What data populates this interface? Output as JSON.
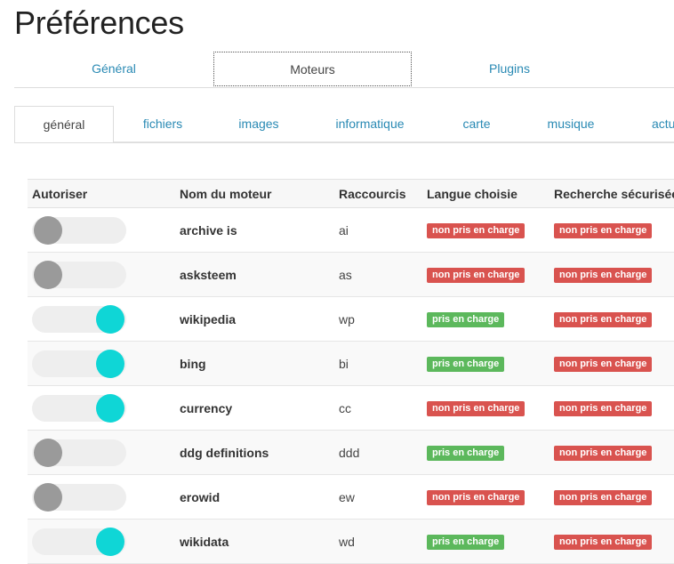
{
  "page": {
    "title": "Préférences"
  },
  "top_tabs": [
    {
      "label": "Général",
      "active": false
    },
    {
      "label": "Moteurs",
      "active": true
    },
    {
      "label": "Plugins",
      "active": false
    }
  ],
  "category_tabs": [
    {
      "label": "général",
      "active": true
    },
    {
      "label": "fichiers",
      "active": false
    },
    {
      "label": "images",
      "active": false
    },
    {
      "label": "informatique",
      "active": false
    },
    {
      "label": "carte",
      "active": false
    },
    {
      "label": "musique",
      "active": false
    },
    {
      "label": "actu",
      "active": false
    }
  ],
  "table": {
    "columns": [
      "Autoriser",
      "Nom du moteur",
      "Raccourcis",
      "Langue choisie",
      "Recherche sécurisée"
    ],
    "rows": [
      {
        "enabled": false,
        "name": "archive is",
        "shortcut": "ai",
        "language": "non pris en charge",
        "safe_search": "non pris en charge"
      },
      {
        "enabled": false,
        "name": "asksteem",
        "shortcut": "as",
        "language": "non pris en charge",
        "safe_search": "non pris en charge"
      },
      {
        "enabled": true,
        "name": "wikipedia",
        "shortcut": "wp",
        "language": "pris en charge",
        "safe_search": "non pris en charge"
      },
      {
        "enabled": true,
        "name": "bing",
        "shortcut": "bi",
        "language": "pris en charge",
        "safe_search": "non pris en charge"
      },
      {
        "enabled": true,
        "name": "currency",
        "shortcut": "cc",
        "language": "non pris en charge",
        "safe_search": "non pris en charge"
      },
      {
        "enabled": false,
        "name": "ddg definitions",
        "shortcut": "ddd",
        "language": "pris en charge",
        "safe_search": "non pris en charge"
      },
      {
        "enabled": false,
        "name": "erowid",
        "shortcut": "ew",
        "language": "non pris en charge",
        "safe_search": "non pris en charge"
      },
      {
        "enabled": true,
        "name": "wikidata",
        "shortcut": "wd",
        "language": "pris en charge",
        "safe_search": "non pris en charge"
      }
    ]
  },
  "colors": {
    "link": "#2a8ab4",
    "toggle_on": "#0fd6d6",
    "toggle_off": "#9a9a9a",
    "badge_supported": "#5cb85c",
    "badge_unsupported": "#d9534f"
  },
  "badge_values": {
    "supported": "pris en charge",
    "unsupported": "non pris en charge"
  }
}
